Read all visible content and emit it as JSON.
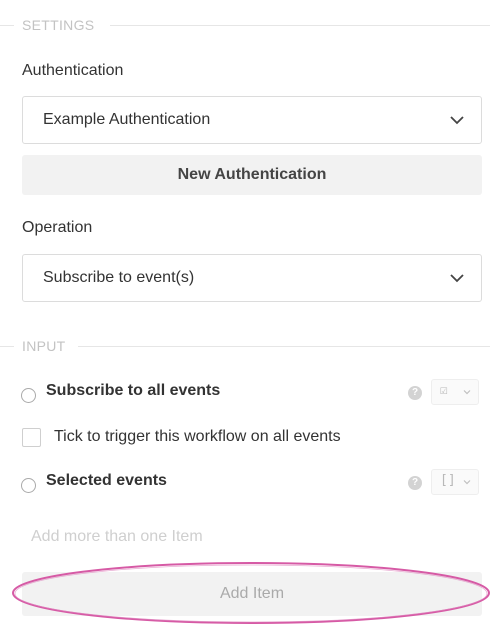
{
  "settings": {
    "section_title": "SETTINGS",
    "authentication_label": "Authentication",
    "authentication_value": "Example Authentication",
    "new_auth_button": "New Authentication",
    "operation_label": "Operation",
    "operation_value": "Subscribe to event(s)"
  },
  "input": {
    "section_title": "INPUT",
    "subscribe_all_label": "Subscribe to all events",
    "subscribe_all_type_glyph": "☑",
    "checkbox_label": "Tick to trigger this workflow on all events",
    "selected_events_label": "Selected events",
    "selected_events_type_glyph": "[]",
    "help_glyph": "?",
    "add_more_placeholder": "Add more than one Item",
    "add_item_button": "Add Item"
  },
  "colors": {
    "highlight": "#d65aa5",
    "button_bg": "#f2f2f2"
  }
}
